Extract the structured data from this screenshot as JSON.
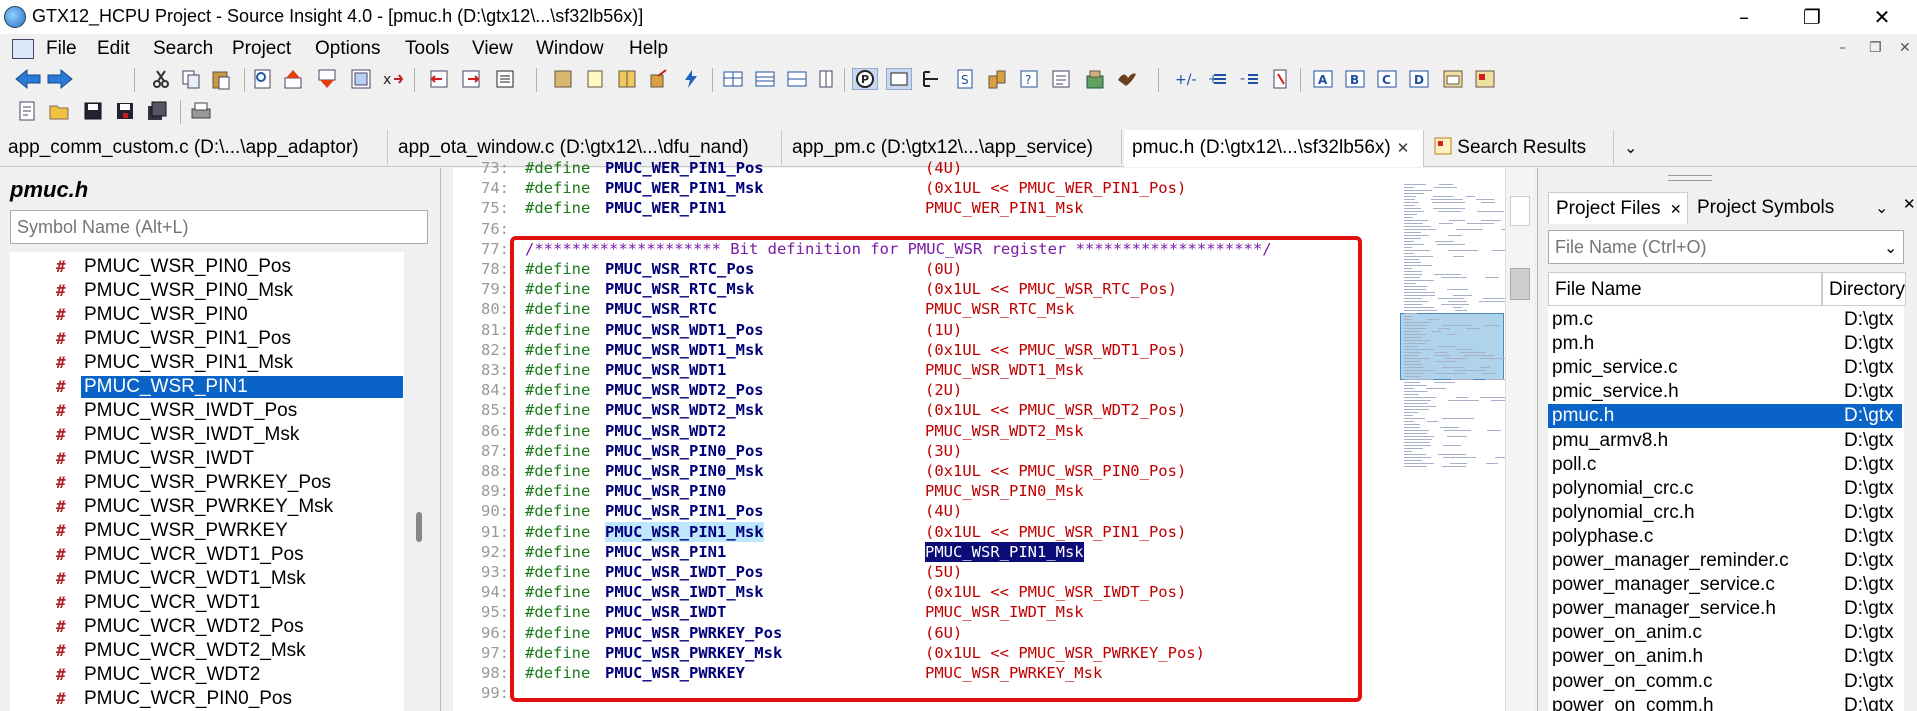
{
  "window": {
    "title": "GTX12_HCPU Project - Source Insight 4.0 - [pmuc.h (D:\\gtx12\\...\\sf32lb56x)]",
    "minimize": "–",
    "maximize": "❐",
    "close": "✕"
  },
  "menu": {
    "items": [
      "File",
      "Edit",
      "Search",
      "Project",
      "Options",
      "Tools",
      "View",
      "Window",
      "Help"
    ],
    "mdi_minimize": "–",
    "mdi_restore": "❐",
    "mdi_close": "✕"
  },
  "tabs": [
    {
      "label": "app_comm_custom.c (D:\\...\\app_adaptor)"
    },
    {
      "label": "app_ota_window.c (D:\\gtx12\\...\\dfu_nand)"
    },
    {
      "label": "app_pm.c (D:\\gtx12\\...\\app_service)"
    },
    {
      "label": "pmuc.h (D:\\gtx12\\...\\sf32lb56x)",
      "close": "✕"
    },
    {
      "label": "Search Results"
    }
  ],
  "tab_overflow": "⌄",
  "symbol_panel": {
    "file_name": "pmuc.h",
    "search_placeholder": "Symbol Name (Alt+L)",
    "items": [
      "PMUC_WSR_PIN0_Pos",
      "PMUC_WSR_PIN0_Msk",
      "PMUC_WSR_PIN0",
      "PMUC_WSR_PIN1_Pos",
      "PMUC_WSR_PIN1_Msk",
      "PMUC_WSR_PIN1",
      "PMUC_WSR_IWDT_Pos",
      "PMUC_WSR_IWDT_Msk",
      "PMUC_WSR_IWDT",
      "PMUC_WSR_PWRKEY_Pos",
      "PMUC_WSR_PWRKEY_Msk",
      "PMUC_WSR_PWRKEY",
      "PMUC_WCR_WDT1_Pos",
      "PMUC_WCR_WDT1_Msk",
      "PMUC_WCR_WDT1",
      "PMUC_WCR_WDT2_Pos",
      "PMUC_WCR_WDT2_Msk",
      "PMUC_WCR_WDT2",
      "PMUC_WCR_PIN0_Pos"
    ],
    "selected_index": 5,
    "symbol_glyph": "#"
  },
  "code": {
    "lines": [
      {
        "n": "73:",
        "kw": "#define",
        "name": "PMUC_WER_PIN1_Pos",
        "val": "(4U)"
      },
      {
        "n": "74:",
        "kw": "#define",
        "name": "PMUC_WER_PIN1_Msk",
        "val": "(0x1UL << PMUC_WER_PIN1_Pos)"
      },
      {
        "n": "75:",
        "kw": "#define",
        "name": "PMUC_WER_PIN1",
        "val": "PMUC_WER_PIN1_Msk"
      },
      {
        "n": "76:",
        "kw": "",
        "name": "",
        "val": ""
      },
      {
        "n": "77:",
        "comment": "/******************** Bit definition for PMUC_WSR register ********************/"
      },
      {
        "n": "78:",
        "kw": "#define",
        "name": "PMUC_WSR_RTC_Pos",
        "val": "(0U)"
      },
      {
        "n": "79:",
        "kw": "#define",
        "name": "PMUC_WSR_RTC_Msk",
        "val": "(0x1UL << PMUC_WSR_RTC_Pos)"
      },
      {
        "n": "80:",
        "kw": "#define",
        "name": "PMUC_WSR_RTC",
        "val": "PMUC_WSR_RTC_Msk"
      },
      {
        "n": "81:",
        "kw": "#define",
        "name": "PMUC_WSR_WDT1_Pos",
        "val": "(1U)"
      },
      {
        "n": "82:",
        "kw": "#define",
        "name": "PMUC_WSR_WDT1_Msk",
        "val": "(0x1UL << PMUC_WSR_WDT1_Pos)"
      },
      {
        "n": "83:",
        "kw": "#define",
        "name": "PMUC_WSR_WDT1",
        "val": "PMUC_WSR_WDT1_Msk"
      },
      {
        "n": "84:",
        "kw": "#define",
        "name": "PMUC_WSR_WDT2_Pos",
        "val": "(2U)"
      },
      {
        "n": "85:",
        "kw": "#define",
        "name": "PMUC_WSR_WDT2_Msk",
        "val": "(0x1UL << PMUC_WSR_WDT2_Pos)"
      },
      {
        "n": "86:",
        "kw": "#define",
        "name": "PMUC_WSR_WDT2",
        "val": "PMUC_WSR_WDT2_Msk"
      },
      {
        "n": "87:",
        "kw": "#define",
        "name": "PMUC_WSR_PIN0_Pos",
        "val": "(3U)"
      },
      {
        "n": "88:",
        "kw": "#define",
        "name": "PMUC_WSR_PIN0_Msk",
        "val": "(0x1UL << PMUC_WSR_PIN0_Pos)"
      },
      {
        "n": "89:",
        "kw": "#define",
        "name": "PMUC_WSR_PIN0",
        "val": "PMUC_WSR_PIN0_Msk"
      },
      {
        "n": "90:",
        "kw": "#define",
        "name": "PMUC_WSR_PIN1_Pos",
        "val": "(4U)"
      },
      {
        "n": "91:",
        "kw": "#define",
        "name": "PMUC_WSR_PIN1_Msk",
        "val": "(0x1UL << PMUC_WSR_PIN1_Pos)",
        "name_hl": "blue"
      },
      {
        "n": "92:",
        "kw": "#define",
        "name": "PMUC_WSR_PIN1",
        "val": "PMUC_WSR_PIN1_Msk",
        "val_hl": "dark"
      },
      {
        "n": "93:",
        "kw": "#define",
        "name": "PMUC_WSR_IWDT_Pos",
        "val": "(5U)"
      },
      {
        "n": "94:",
        "kw": "#define",
        "name": "PMUC_WSR_IWDT_Msk",
        "val": "(0x1UL << PMUC_WSR_IWDT_Pos)"
      },
      {
        "n": "95:",
        "kw": "#define",
        "name": "PMUC_WSR_IWDT",
        "val": "PMUC_WSR_IWDT_Msk"
      },
      {
        "n": "96:",
        "kw": "#define",
        "name": "PMUC_WSR_PWRKEY_Pos",
        "val": "(6U)"
      },
      {
        "n": "97:",
        "kw": "#define",
        "name": "PMUC_WSR_PWRKEY_Msk",
        "val": "(0x1UL << PMUC_WSR_PWRKEY_Pos)"
      },
      {
        "n": "98:",
        "kw": "#define",
        "name": "PMUC_WSR_PWRKEY",
        "val": "PMUC_WSR_PWRKEY_Msk"
      },
      {
        "n": "99:",
        "kw": "",
        "name": "",
        "val": ""
      }
    ]
  },
  "project_panel": {
    "tabs": [
      {
        "label": "Project Files",
        "close": "✕"
      },
      {
        "label": "Project Symbols"
      }
    ],
    "tab_dropdown": "⌄",
    "panel_close": "✕",
    "search_placeholder": "File Name (Ctrl+O)",
    "search_dropdown": "⌄",
    "columns": [
      "File Name",
      "Directory"
    ],
    "files": [
      {
        "name": "pm.c",
        "dir": "D:\\gtx"
      },
      {
        "name": "pm.h",
        "dir": "D:\\gtx"
      },
      {
        "name": "pmic_service.c",
        "dir": "D:\\gtx"
      },
      {
        "name": "pmic_service.h",
        "dir": "D:\\gtx"
      },
      {
        "name": "pmuc.h",
        "dir": "D:\\gtx"
      },
      {
        "name": "pmu_armv8.h",
        "dir": "D:\\gtx"
      },
      {
        "name": "poll.c",
        "dir": "D:\\gtx"
      },
      {
        "name": "polynomial_crc.c",
        "dir": "D:\\gtx"
      },
      {
        "name": "polynomial_crc.h",
        "dir": "D:\\gtx"
      },
      {
        "name": "polyphase.c",
        "dir": "D:\\gtx"
      },
      {
        "name": "power_manager_reminder.c",
        "dir": "D:\\gtx"
      },
      {
        "name": "power_manager_service.c",
        "dir": "D:\\gtx"
      },
      {
        "name": "power_manager_service.h",
        "dir": "D:\\gtx"
      },
      {
        "name": "power_on_anim.c",
        "dir": "D:\\gtx"
      },
      {
        "name": "power_on_anim.h",
        "dir": "D:\\gtx"
      },
      {
        "name": "power_on_comm.c",
        "dir": "D:\\gtx"
      },
      {
        "name": "power_on_comm.h",
        "dir": "D:\\gtx"
      }
    ],
    "selected_index": 4
  },
  "colors": {
    "selection": "#0a64c8",
    "annotation_box": "#e01010",
    "keyword": "#1a7a1a",
    "identifier": "#00007a",
    "value": "#c00000",
    "comment": "#7a1aa8"
  }
}
